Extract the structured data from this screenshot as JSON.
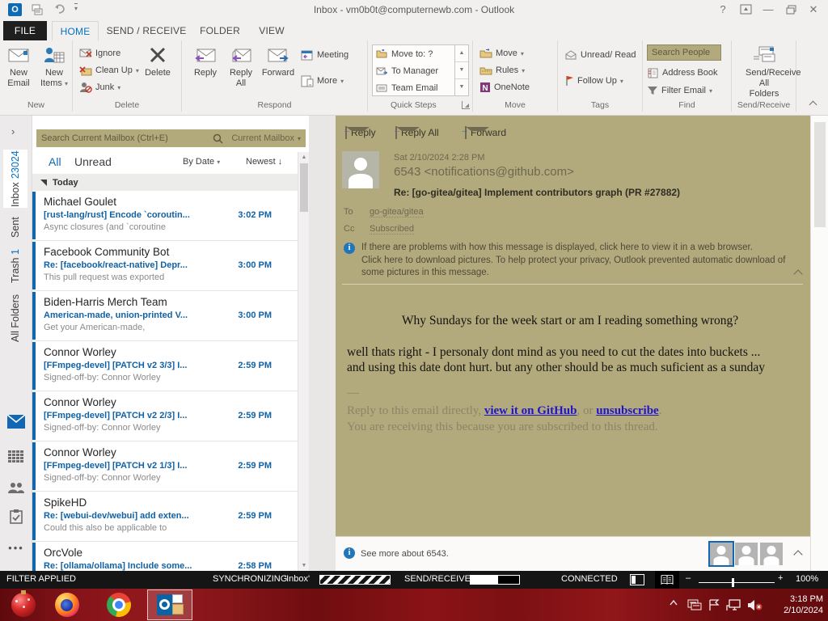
{
  "window": {
    "title": "Inbox - vm0b0t@computernewb.com - Outlook"
  },
  "tabs": {
    "file": "FILE",
    "home": "HOME",
    "send_receive": "SEND / RECEIVE",
    "folder": "FOLDER",
    "view": "VIEW"
  },
  "ribbon": {
    "new_email": "New Email",
    "new_items": "New Items",
    "ignore": "Ignore",
    "clean_up": "Clean Up",
    "junk": "Junk",
    "delete": "Delete",
    "reply": "Reply",
    "reply_all_1": "Reply",
    "reply_all_2": "All",
    "forward": "Forward",
    "meeting": "Meeting",
    "more": "More",
    "quick_steps": [
      "Move to: ?",
      "To Manager",
      "Team Email"
    ],
    "move": "Move",
    "rules": "Rules",
    "onenote": "OneNote",
    "unread_read": "Unread/ Read",
    "follow_up": "Follow Up",
    "search_people_placeholder": "Search People",
    "address_book": "Address Book",
    "filter_email": "Filter Email",
    "send_receive_all_1": "Send/Receive",
    "send_receive_all_2": "All Folders",
    "groups": {
      "new": "New",
      "delete": "Delete",
      "respond": "Respond",
      "quick_steps": "Quick Steps",
      "move": "Move",
      "tags": "Tags",
      "find": "Find",
      "send_receive": "Send/Receive"
    }
  },
  "nav": {
    "folders": [
      {
        "label": "Inbox",
        "count": "23024"
      },
      {
        "label": "Sent",
        "count": ""
      },
      {
        "label": "Trash",
        "count": "1"
      },
      {
        "label": "All Folders",
        "count": ""
      }
    ]
  },
  "mail_list": {
    "search_placeholder": "Search Current Mailbox (Ctrl+E)",
    "scope": "Current Mailbox",
    "filter_all": "All",
    "filter_unread": "Unread",
    "sort_by": "By Date",
    "sort_order": "Newest ↓",
    "group_header": "Today",
    "emails": [
      {
        "sender": "Michael Goulet",
        "subject": "[rust-lang/rust] Encode `coroutin...",
        "time": "3:02 PM",
        "preview": "Async closures (and `coroutine"
      },
      {
        "sender": "Facebook Community Bot",
        "subject": "Re: [facebook/react-native] Depr...",
        "time": "3:00 PM",
        "preview": "This pull request was exported"
      },
      {
        "sender": "Biden-Harris Merch Team",
        "subject": "American-made, union-printed V...",
        "time": "3:00 PM",
        "preview": "Get your American-made,"
      },
      {
        "sender": "Connor Worley",
        "subject": "[FFmpeg-devel] [PATCH v2 3/3] I...",
        "time": "2:59 PM",
        "preview": "Signed-off-by: Connor Worley"
      },
      {
        "sender": "Connor Worley",
        "subject": "[FFmpeg-devel] [PATCH v2 2/3] I...",
        "time": "2:59 PM",
        "preview": "Signed-off-by: Connor Worley"
      },
      {
        "sender": "Connor Worley",
        "subject": "[FFmpeg-devel] [PATCH v2 1/3] I...",
        "time": "2:59 PM",
        "preview": "Signed-off-by: Connor Worley"
      },
      {
        "sender": "SpikeHD",
        "subject": "Re: [webui-dev/webui] add exten...",
        "time": "2:59 PM",
        "preview": "Could this also be applicable to"
      },
      {
        "sender": "OrcVole",
        "subject": "Re: [ollama/ollama] Include some...",
        "time": "2:58 PM",
        "preview": ""
      }
    ]
  },
  "reading_pane": {
    "reply": "Reply",
    "reply_all": "Reply All",
    "forward": "Forward",
    "date": "Sat 2/10/2024 2:28 PM",
    "sender": "6543 <notifications@github.com>",
    "subject": "Re: [go-gitea/gitea] Implement contributors graph (PR #27882)",
    "to_label": "To",
    "to_value": "go-gitea/gitea",
    "cc_label": "Cc",
    "cc_value": "Subscribed",
    "info_line1": "If there are problems with how this message is displayed, click here to view it in a web browser.",
    "info_line2": "Click here to download pictures. To help protect your privacy, Outlook prevented automatic download of some pictures in this message.",
    "body": {
      "quote": "Why Sundays for the week start or am I reading something wrong?",
      "line1": "well thats right - I personaly dont mind as you need to cut the dates into buckets ...",
      "line2": "and using this date dont hurt. but any other should be as much suficient as a sunday",
      "separator": "—",
      "footer_prefix": "Reply to this email directly, ",
      "footer_link1": "view it on GitHub",
      "footer_mid": ", or ",
      "footer_link2": "unsubscribe",
      "footer_suffix": ".",
      "footer_line2": "You are receiving this because you are subscribed to this thread."
    },
    "see_more": "See more about 6543."
  },
  "status_bar": {
    "filter": "FILTER APPLIED",
    "sync_label": "SYNCHRONIZING",
    "sync_target": "'Inbox'",
    "send_receive": "SEND/RECEIVE",
    "connected": "CONNECTED",
    "zoom": "100%"
  },
  "taskbar": {
    "time": "3:18 PM",
    "date": "2/10/2024"
  },
  "colors": {
    "accent": "#0072c6",
    "unread_blue": "#0f62a6",
    "reading_khaki": "#b2a97c",
    "flag_red": "#e03c00",
    "taskbar_red": "#7d1013"
  }
}
